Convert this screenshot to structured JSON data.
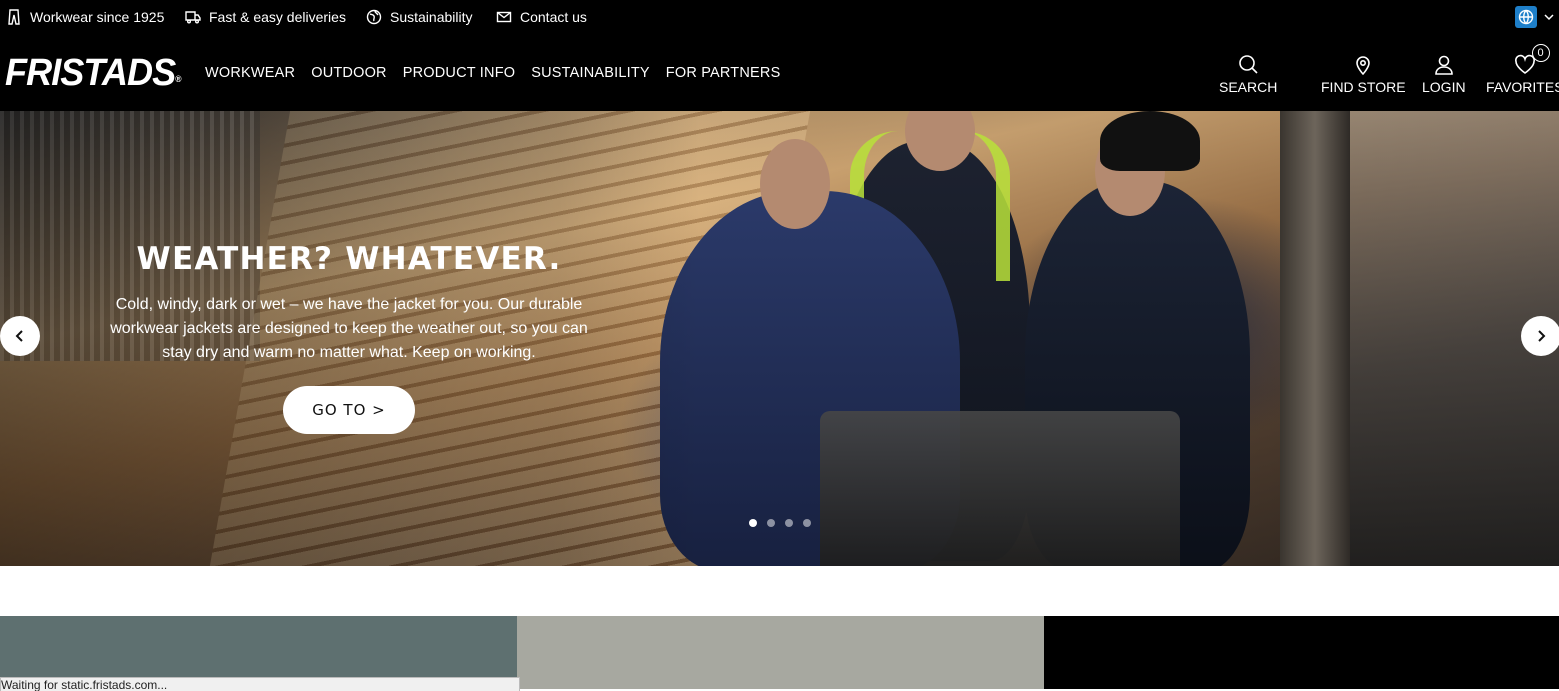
{
  "topbar": {
    "usps": [
      {
        "label": "Workwear since 1925",
        "icon": "trousers-icon"
      },
      {
        "label": "Fast & easy deliveries",
        "icon": "truck-icon"
      },
      {
        "label": "Sustainability",
        "icon": "globe-leaf-icon"
      },
      {
        "label": "Contact us",
        "icon": "envelope-icon"
      }
    ],
    "language_icon": "globe-icon"
  },
  "header": {
    "logo": "FRISTADS",
    "logo_mark": "®",
    "nav": [
      "WORKWEAR",
      "OUTDOOR",
      "PRODUCT INFO",
      "SUSTAINABILITY",
      "FOR PARTNERS"
    ],
    "tools": {
      "search": "SEARCH",
      "find_store": "FIND STORE",
      "login": "LOGIN",
      "favorites": "FAVORITES",
      "favorites_count": "0"
    }
  },
  "hero": {
    "title": "WEATHER? WHATEVER.",
    "text": "Cold, windy, dark or wet – we have the jacket for you. Our durable workwear jackets are designed to keep the weather out, so you can stay dry and warm no matter what. Keep on working.",
    "cta": "GO TO >",
    "slide_count": 4,
    "active_slide": 1
  },
  "tiles": {
    "colors": [
      "#5e7070",
      "#a7a8a0",
      "#000000"
    ]
  },
  "status_bar": {
    "text": "Waiting for static.fristads.com..."
  }
}
